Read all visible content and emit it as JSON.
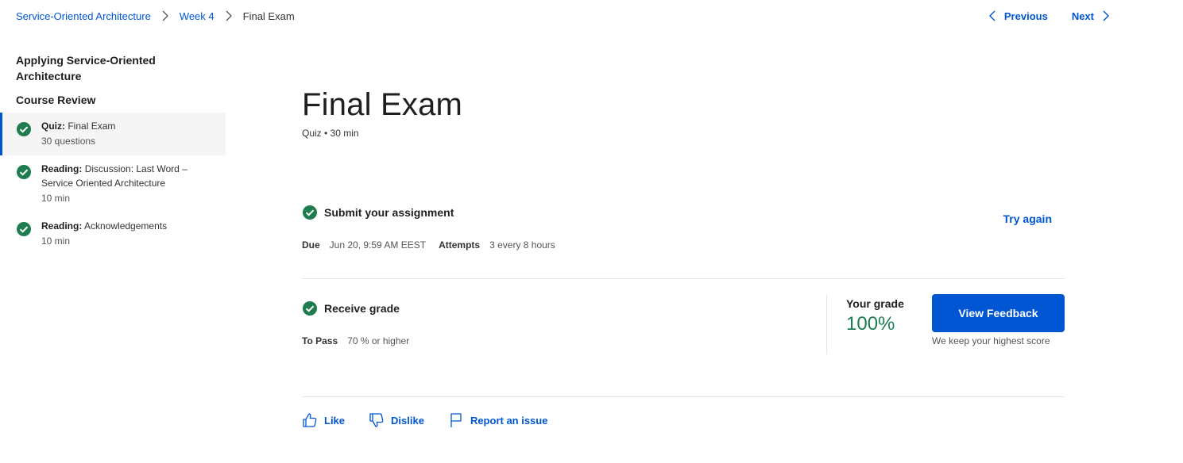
{
  "breadcrumb": {
    "items": [
      "Service-Oriented Architecture",
      "Week 4"
    ],
    "current": "Final Exam"
  },
  "pager": {
    "previous": "Previous",
    "next": "Next"
  },
  "sidebar": {
    "module_title": "Applying Service-Oriented Architecture",
    "section_title": "Course Review",
    "items": [
      {
        "kind": "Quiz:",
        "name": "Final Exam",
        "meta": "30 questions"
      },
      {
        "kind": "Reading:",
        "name": "Discussion: Last Word – Service Oriented Architecture",
        "meta": "10 min"
      },
      {
        "kind": "Reading:",
        "name": "Acknowledgements",
        "meta": "10 min"
      }
    ]
  },
  "main": {
    "title": "Final Exam",
    "subtitle": "Quiz • 30 min",
    "submit": {
      "heading": "Submit your assignment",
      "due_label": "Due",
      "due_value": "Jun 20, 9:59 AM EEST",
      "attempts_label": "Attempts",
      "attempts_value": "3 every 8 hours",
      "try_again": "Try again"
    },
    "grade": {
      "heading": "Receive grade",
      "pass_label": "To Pass",
      "pass_value": "70 % or higher",
      "your_grade_label": "Your grade",
      "your_grade_value": "100%",
      "feedback_button": "View Feedback",
      "feedback_note": "We keep your highest score"
    },
    "actions": {
      "like": "Like",
      "dislike": "Dislike",
      "report": "Report an issue"
    }
  },
  "colors": {
    "accent": "#0056d2",
    "success": "#1e7d4f"
  }
}
